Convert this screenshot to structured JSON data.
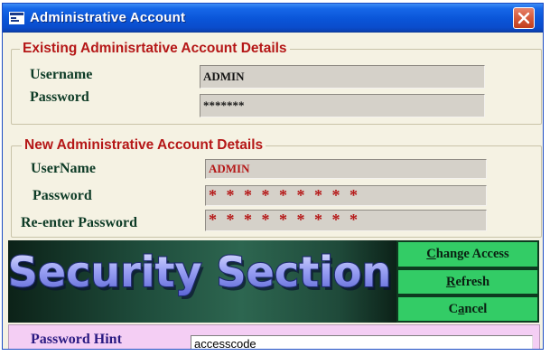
{
  "window": {
    "title": "Administrative Account",
    "icon": "app-window-icon",
    "close_icon": "close-x-icon"
  },
  "existing_account": {
    "title": "Existing Adminisrtative Account Details",
    "username_label": "Username",
    "username_value": "ADMIN",
    "password_label": "Password",
    "password_value": "*******"
  },
  "new_account": {
    "title": "New Administrative Account Details",
    "username_label": "UserName",
    "username_value": "ADMIN",
    "password_label": "Password",
    "password_value": "* * * * * * * * *",
    "reenter_label": "Re-enter Password",
    "reenter_value": "* * * * * * * * *"
  },
  "banner": {
    "text": "Security Section"
  },
  "buttons": {
    "change_access": "Change Access",
    "refresh": "Refresh",
    "cancel": "Cancel"
  },
  "hint": {
    "label": "Password Hint",
    "value": "accesscode"
  },
  "colors": {
    "title_bar": "#0a55d8",
    "section_title": "#b51717",
    "labels": "#0d3b26",
    "button_bg": "#33cc66",
    "hint_strip": "#f4cef4",
    "dialog_bg": "#f5f2e3"
  }
}
